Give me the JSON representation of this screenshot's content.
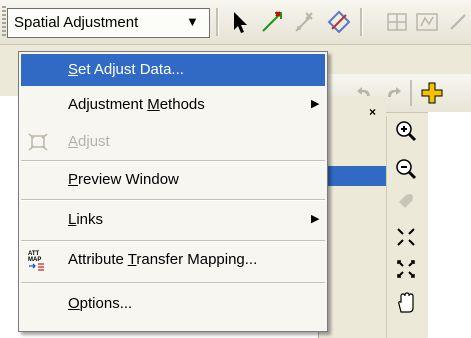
{
  "toolbar": {
    "dropdown_label": "Spatial Adjustment",
    "dropdown_caret": "▼",
    "icons": [
      "select-arrow-icon",
      "new-displacement-link-icon",
      "modify-link-icon",
      "multi-displacement-link-icon",
      "new-identity-link-icon",
      "new-limited-adjustment-area-icon"
    ]
  },
  "menu": {
    "items": [
      {
        "pre": "",
        "key": "S",
        "post": "et Adjust Data...",
        "selected": true,
        "enabled": true,
        "submenu": false,
        "icon": ""
      },
      {
        "pre": "Adjustment ",
        "key": "M",
        "post": "ethods",
        "selected": false,
        "enabled": true,
        "submenu": true,
        "icon": ""
      },
      {
        "pre": "",
        "key": "A",
        "post": "djust",
        "selected": false,
        "enabled": false,
        "submenu": false,
        "icon": "adjust-icon"
      },
      {
        "pre": "",
        "key": "P",
        "post": "review Window",
        "selected": false,
        "enabled": true,
        "submenu": false,
        "icon": ""
      },
      {
        "pre": "",
        "key": "L",
        "post": "inks",
        "selected": false,
        "enabled": true,
        "submenu": true,
        "icon": ""
      },
      {
        "pre": "Attribute ",
        "key": "T",
        "post": "ransfer Mapping...",
        "selected": false,
        "enabled": true,
        "submenu": false,
        "icon": "attribute-transfer-mapping-icon"
      },
      {
        "pre": "",
        "key": "O",
        "post": "ptions...",
        "selected": false,
        "enabled": true,
        "submenu": false,
        "icon": ""
      }
    ],
    "submenu_arrow": "▶",
    "att_icon_text": [
      "ATT",
      "MAP"
    ]
  },
  "pane": {
    "close": "×"
  },
  "tools": [
    "zoom-in-icon",
    "zoom-out-icon",
    "pan-icon",
    "fixed-zoom-in-icon",
    "fixed-zoom-out-icon",
    "hand-pan-icon"
  ],
  "colors": {
    "selection": "#316ac5",
    "menu_bg": "#f7f6f1",
    "toolbar_bg": "#ece9d8"
  }
}
